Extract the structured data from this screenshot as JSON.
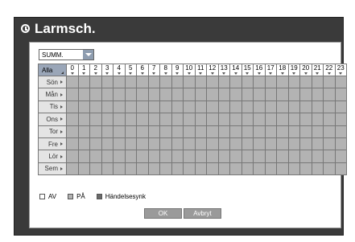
{
  "window": {
    "title": "Larmsch."
  },
  "dropdown": {
    "value": "SUMM."
  },
  "grid": {
    "corner_label": "Alla",
    "hours": [
      "0",
      "1",
      "2",
      "3",
      "4",
      "5",
      "6",
      "7",
      "8",
      "9",
      "10",
      "11",
      "12",
      "13",
      "14",
      "15",
      "16",
      "17",
      "18",
      "19",
      "20",
      "21",
      "22",
      "23"
    ],
    "days": [
      "Sön",
      "Mån",
      "Tis",
      "Ons",
      "Tor",
      "Fre",
      "Lör",
      "Sem"
    ]
  },
  "legend": {
    "off": {
      "label": "AV",
      "color": "#ffffff"
    },
    "on": {
      "label": "PÅ",
      "color": "#b3b3b3"
    },
    "event": {
      "label": "Händelsesynk",
      "color": "#6a6a6a"
    }
  },
  "buttons": {
    "ok": "OK",
    "cancel": "Avbryt"
  }
}
